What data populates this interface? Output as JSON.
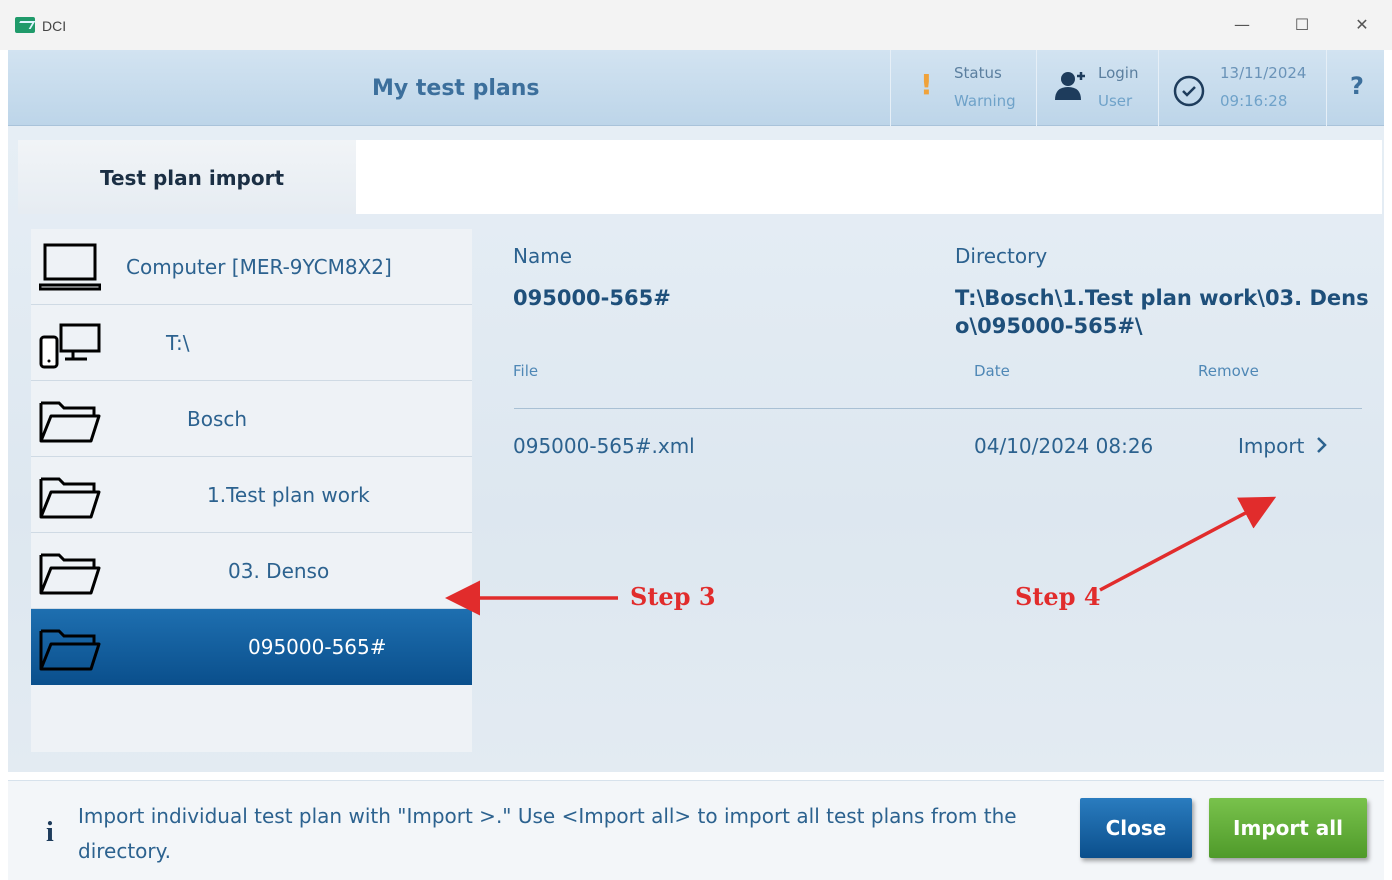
{
  "window": {
    "title": "DCI",
    "minimize": "—",
    "maximize": "☐",
    "close": "✕"
  },
  "header": {
    "title": "My test plans",
    "status_label": "Status",
    "status_value": "Warning",
    "login_label": "Login",
    "login_value": "User",
    "date": "13/11/2024",
    "time": "09:16:28",
    "help": "?"
  },
  "tab": {
    "label": "Test plan import"
  },
  "tree": {
    "items": [
      {
        "label": "Computer [MER-9YCM8X2]",
        "icon": "laptop-icon"
      },
      {
        "label": "T:\\",
        "icon": "devices-icon"
      },
      {
        "label": "Bosch",
        "icon": "folder-icon"
      },
      {
        "label": "1.Test plan work",
        "icon": "folder-icon"
      },
      {
        "label": "03. Denso",
        "icon": "folder-icon"
      },
      {
        "label": "095000-565#",
        "icon": "folder-icon",
        "selected": true
      }
    ]
  },
  "detail": {
    "name_label": "Name",
    "name_value": "095000-565#",
    "dir_label": "Directory",
    "dir_line1": "T:\\Bosch\\1.Test plan work\\03. Dens",
    "dir_line2": "o\\095000-565#\\",
    "col_file": "File",
    "col_date": "Date",
    "col_remove": "Remove",
    "row": {
      "file": "095000-565#.xml",
      "date": "04/10/2024 08:26",
      "action": "Import"
    }
  },
  "annotations": {
    "step3": "Step 3",
    "step4": "Step 4",
    "color": "#e12c2c"
  },
  "footer": {
    "info": "i",
    "text": "Import individual test plan with \"Import >.\" Use <Import all> to import all test plans from the directory.",
    "close_label": "Close",
    "import_all_label": "Import all"
  },
  "colors": {
    "accent_blue": "#0b4f8c",
    "accent_green": "#5aa534",
    "warning": "#f0a23a"
  }
}
